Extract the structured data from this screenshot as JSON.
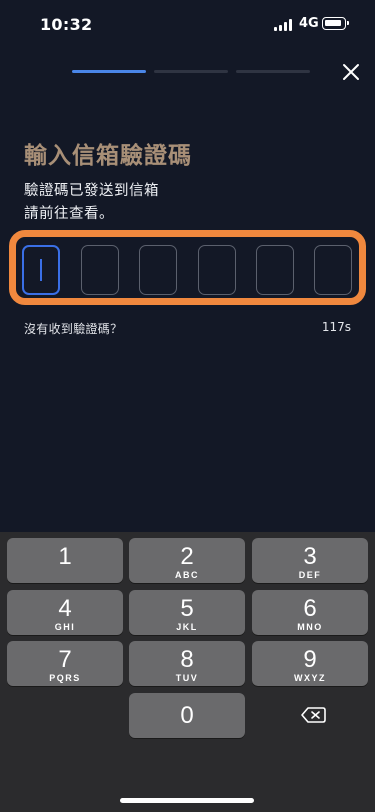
{
  "status": {
    "time": "10:32",
    "network": "4G"
  },
  "progress": {
    "steps": 3,
    "current": 1
  },
  "page": {
    "title": "輸入信箱驗證碼",
    "desc_line1": "驗證碼已發送到信箱",
    "desc_line2": "請前往查看。"
  },
  "code": {
    "length": 6,
    "focused_index": 0
  },
  "resend": {
    "label": "沒有收到驗證碼？",
    "countdown": "117s"
  },
  "keypad": [
    {
      "num": "1",
      "letters": ""
    },
    {
      "num": "2",
      "letters": "ABC"
    },
    {
      "num": "3",
      "letters": "DEF"
    },
    {
      "num": "4",
      "letters": "GHI"
    },
    {
      "num": "5",
      "letters": "JKL"
    },
    {
      "num": "6",
      "letters": "MNO"
    },
    {
      "num": "7",
      "letters": "PQRS"
    },
    {
      "num": "8",
      "letters": "TUV"
    },
    {
      "num": "9",
      "letters": "WXYZ"
    },
    {
      "num": "0",
      "letters": ""
    }
  ],
  "icons": {
    "close": "close-icon",
    "delete": "backspace-icon"
  },
  "colors": {
    "background": "#131826",
    "accent": "#4a86e8",
    "title": "#a88f77",
    "highlight_frame": "#f0883e"
  }
}
